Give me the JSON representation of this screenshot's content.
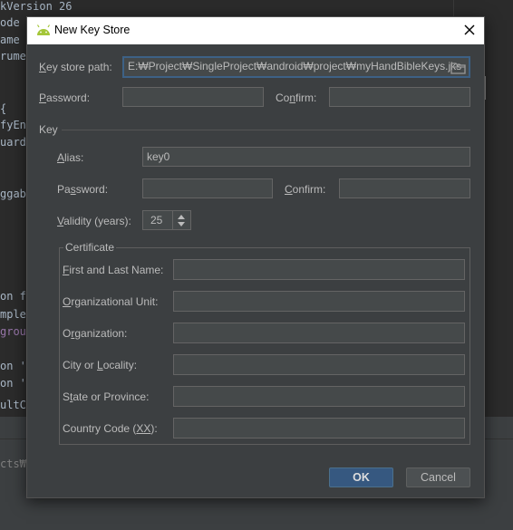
{
  "background_code": {
    "lines": [
      "kVersion 26",
      "ode ?",
      "ame \"",
      "rumen",
      "",
      "",
      "{",
      "fyEna",
      "uardF",
      "",
      "",
      "ggabl",
      "",
      "",
      "",
      "",
      "",
      "on fi",
      "mplem",
      "group",
      "",
      "on 'c",
      "on 'c",
      "ultCo"
    ],
    "bottom_text": "cts₩M"
  },
  "dialog": {
    "title": "New Key Store",
    "key_store_path": {
      "label_pre": "",
      "label_mn": "K",
      "label_post": "ey store path:",
      "value": "E:₩Project₩SingleProject₩android₩project₩myHandBibleKeys.jks"
    },
    "store_password": {
      "label_pre": "",
      "label_mn": "P",
      "label_post": "assword:",
      "value": ""
    },
    "store_confirm": {
      "label_pre": "Co",
      "label_mn": "n",
      "label_post": "firm:",
      "value": ""
    },
    "key_section": "Key",
    "alias": {
      "label_pre": "",
      "label_mn": "A",
      "label_post": "lias:",
      "value": "key0"
    },
    "key_password": {
      "label_pre": "Pa",
      "label_mn": "s",
      "label_post": "sword:",
      "value": ""
    },
    "key_confirm": {
      "label_pre": "",
      "label_mn": "C",
      "label_post": "onfirm:",
      "value": ""
    },
    "validity": {
      "label_pre": "",
      "label_mn": "V",
      "label_post": "alidity (years):",
      "value": "25"
    },
    "certificate": {
      "title": "Certificate",
      "fields": [
        {
          "label_pre": "",
          "label_mn": "F",
          "label_post": "irst and Last Name:",
          "value": ""
        },
        {
          "label_pre": "",
          "label_mn": "O",
          "label_post": "rganizational Unit:",
          "value": ""
        },
        {
          "label_pre": "O",
          "label_mn": "r",
          "label_post": "ganization:",
          "value": ""
        },
        {
          "label_pre": "City or ",
          "label_mn": "L",
          "label_post": "ocality:",
          "value": ""
        },
        {
          "label_pre": "S",
          "label_mn": "t",
          "label_post": "ate or Province:",
          "value": ""
        },
        {
          "label_pre": "Country Code (",
          "label_mn": "XX",
          "label_post": "):",
          "value": ""
        }
      ]
    },
    "ok_label": "OK",
    "cancel_label": "Cancel"
  },
  "colors": {
    "dialog_bg": "#3c3f41",
    "field_bg": "#45494a",
    "focus_border": "#3d6185",
    "ok_bg": "#365880",
    "android_green": "#a4c639"
  },
  "icons": [
    "android-icon",
    "close-icon",
    "folder-browse-icon",
    "spinner-up-icon",
    "spinner-down-icon"
  ]
}
